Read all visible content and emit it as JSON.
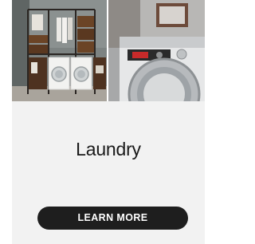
{
  "card": {
    "title": "Laundry",
    "cta_label": "LEARN MORE"
  },
  "images": {
    "left": "laundry-room-shelving-image",
    "right": "professional-washing-machine-image"
  }
}
